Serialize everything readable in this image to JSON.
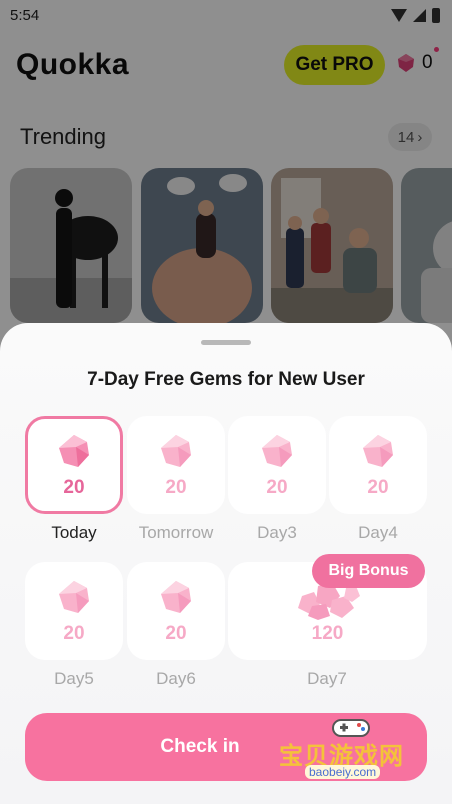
{
  "status": {
    "time": "5:54"
  },
  "header": {
    "app_title": "Quokka",
    "pro_label": "Get PRO",
    "gem_count": "0"
  },
  "trending": {
    "title": "Trending",
    "count": "14"
  },
  "sheet": {
    "title": "7-Day Free Gems for New User",
    "days": [
      {
        "amount": "20",
        "label": "Today"
      },
      {
        "amount": "20",
        "label": "Tomorrow"
      },
      {
        "amount": "20",
        "label": "Day3"
      },
      {
        "amount": "20",
        "label": "Day4"
      },
      {
        "amount": "20",
        "label": "Day5"
      },
      {
        "amount": "20",
        "label": "Day6"
      },
      {
        "amount": "120",
        "label": "Day7"
      }
    ],
    "bonus_label": "Big Bonus",
    "checkin_label": "Check in"
  },
  "watermark": {
    "cn": "宝贝游戏网",
    "url": "baobeiy.com"
  },
  "colors": {
    "accent": "#f7729f",
    "pro": "#e6f227",
    "gem": "#f59bbd"
  },
  "icons": [
    "wifi-icon",
    "signal-icon",
    "battery-icon",
    "gem-icon",
    "chevron-right-icon"
  ]
}
